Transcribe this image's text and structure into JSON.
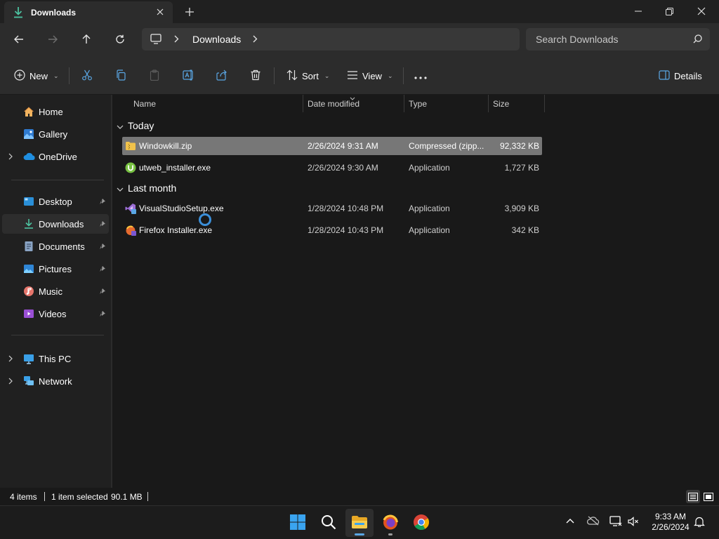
{
  "window": {
    "tab_title": "Downloads",
    "new_tab_icon": "plus-icon"
  },
  "nav": {
    "address_segment": "Downloads",
    "search_placeholder": "Search Downloads"
  },
  "commands": {
    "new_label": "New",
    "sort_label": "Sort",
    "view_label": "View",
    "details_label": "Details"
  },
  "sidebar": {
    "items": [
      {
        "label": "Home",
        "icon": "home-icon"
      },
      {
        "label": "Gallery",
        "icon": "gallery-icon"
      },
      {
        "label": "OneDrive",
        "icon": "cloud-icon"
      },
      {
        "label": "Desktop",
        "icon": "desktop-icon"
      },
      {
        "label": "Downloads",
        "icon": "download-icon"
      },
      {
        "label": "Documents",
        "icon": "documents-icon"
      },
      {
        "label": "Pictures",
        "icon": "pictures-icon"
      },
      {
        "label": "Music",
        "icon": "music-icon"
      },
      {
        "label": "Videos",
        "icon": "videos-icon"
      },
      {
        "label": "This PC",
        "icon": "pc-icon"
      },
      {
        "label": "Network",
        "icon": "network-icon"
      }
    ]
  },
  "columns": {
    "name": "Name",
    "date": "Date modified",
    "type": "Type",
    "size": "Size"
  },
  "groups": [
    {
      "label": "Today",
      "files": [
        {
          "name": "Windowkill.zip",
          "date": "2/26/2024 9:31 AM",
          "type": "Compressed (zipp...",
          "size": "92,332 KB",
          "selected": true
        },
        {
          "name": "utweb_installer.exe",
          "date": "2/26/2024 9:30 AM",
          "type": "Application",
          "size": "1,727 KB",
          "selected": false
        }
      ]
    },
    {
      "label": "Last month",
      "files": [
        {
          "name": "VisualStudioSetup.exe",
          "date": "1/28/2024 10:48 PM",
          "type": "Application",
          "size": "3,909 KB",
          "selected": false
        },
        {
          "name": "Firefox Installer.exe",
          "date": "1/28/2024 10:43 PM",
          "type": "Application",
          "size": "342 KB",
          "selected": false
        }
      ]
    }
  ],
  "status": {
    "item_count": "4 items",
    "selection": "1 item selected",
    "selection_size": "90.1 MB"
  },
  "taskbar": {
    "time": "9:33 AM",
    "date": "2/26/2024"
  },
  "colors": {
    "accent": "#3b8fd9",
    "selected_row": "#777777"
  }
}
